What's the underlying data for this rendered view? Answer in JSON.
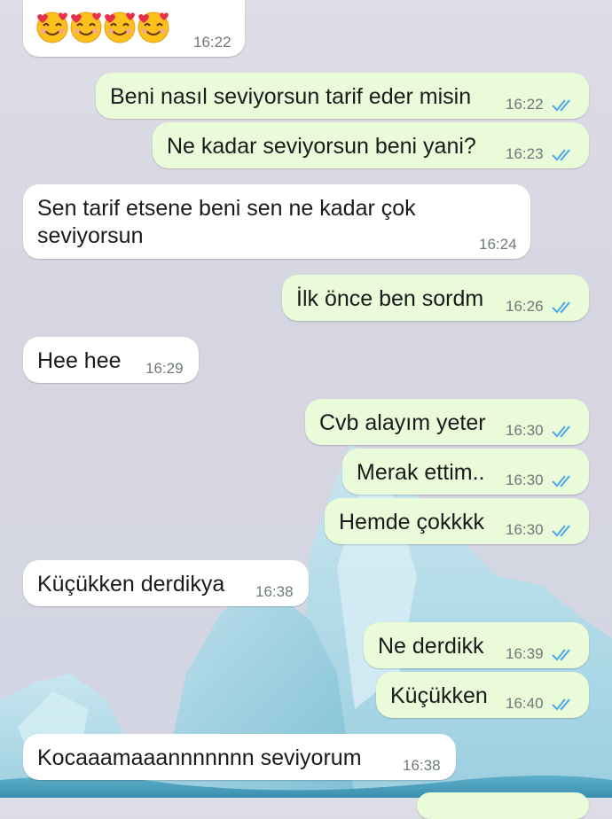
{
  "colors": {
    "incoming_bubble": "#ffffff",
    "outgoing_bubble": "#e9fbd9",
    "timestamp": "#6f7a7a",
    "read_ticks": "#4fa6e8"
  },
  "icons": {
    "reaction": "smiling-face-with-hearts",
    "read_receipt": "double-check-mark"
  },
  "messages": [
    {
      "direction": "in",
      "text": "",
      "time": "16:22",
      "emoji_count": 4
    },
    {
      "direction": "out",
      "text": "Beni nasıl seviyorsun tarif eder misin",
      "time": "16:22",
      "read": true
    },
    {
      "direction": "out",
      "text": "Ne kadar seviyorsun beni yani?",
      "time": "16:23",
      "read": true
    },
    {
      "direction": "in",
      "text": "Sen tarif etsene beni sen ne kadar çok seviyorsun",
      "time": "16:24"
    },
    {
      "direction": "out",
      "text": "İlk önce ben sordm",
      "time": "16:26",
      "read": true
    },
    {
      "direction": "in",
      "text": "Hee hee",
      "time": "16:29"
    },
    {
      "direction": "out",
      "text": "Cvb alayım yeter",
      "time": "16:30",
      "read": true
    },
    {
      "direction": "out",
      "text": "Merak ettim..",
      "time": "16:30",
      "read": true
    },
    {
      "direction": "out",
      "text": "Hemde çokkkk",
      "time": "16:30",
      "read": true
    },
    {
      "direction": "in",
      "text": "Küçükken derdikya",
      "time": "16:38"
    },
    {
      "direction": "out",
      "text": "Ne derdikk",
      "time": "16:39",
      "read": true
    },
    {
      "direction": "out",
      "text": "Küçükken",
      "time": "16:40",
      "read": true
    },
    {
      "direction": "in",
      "text": "Kocaaamaaannnnnnn seviyorum",
      "time": "16:38"
    }
  ]
}
